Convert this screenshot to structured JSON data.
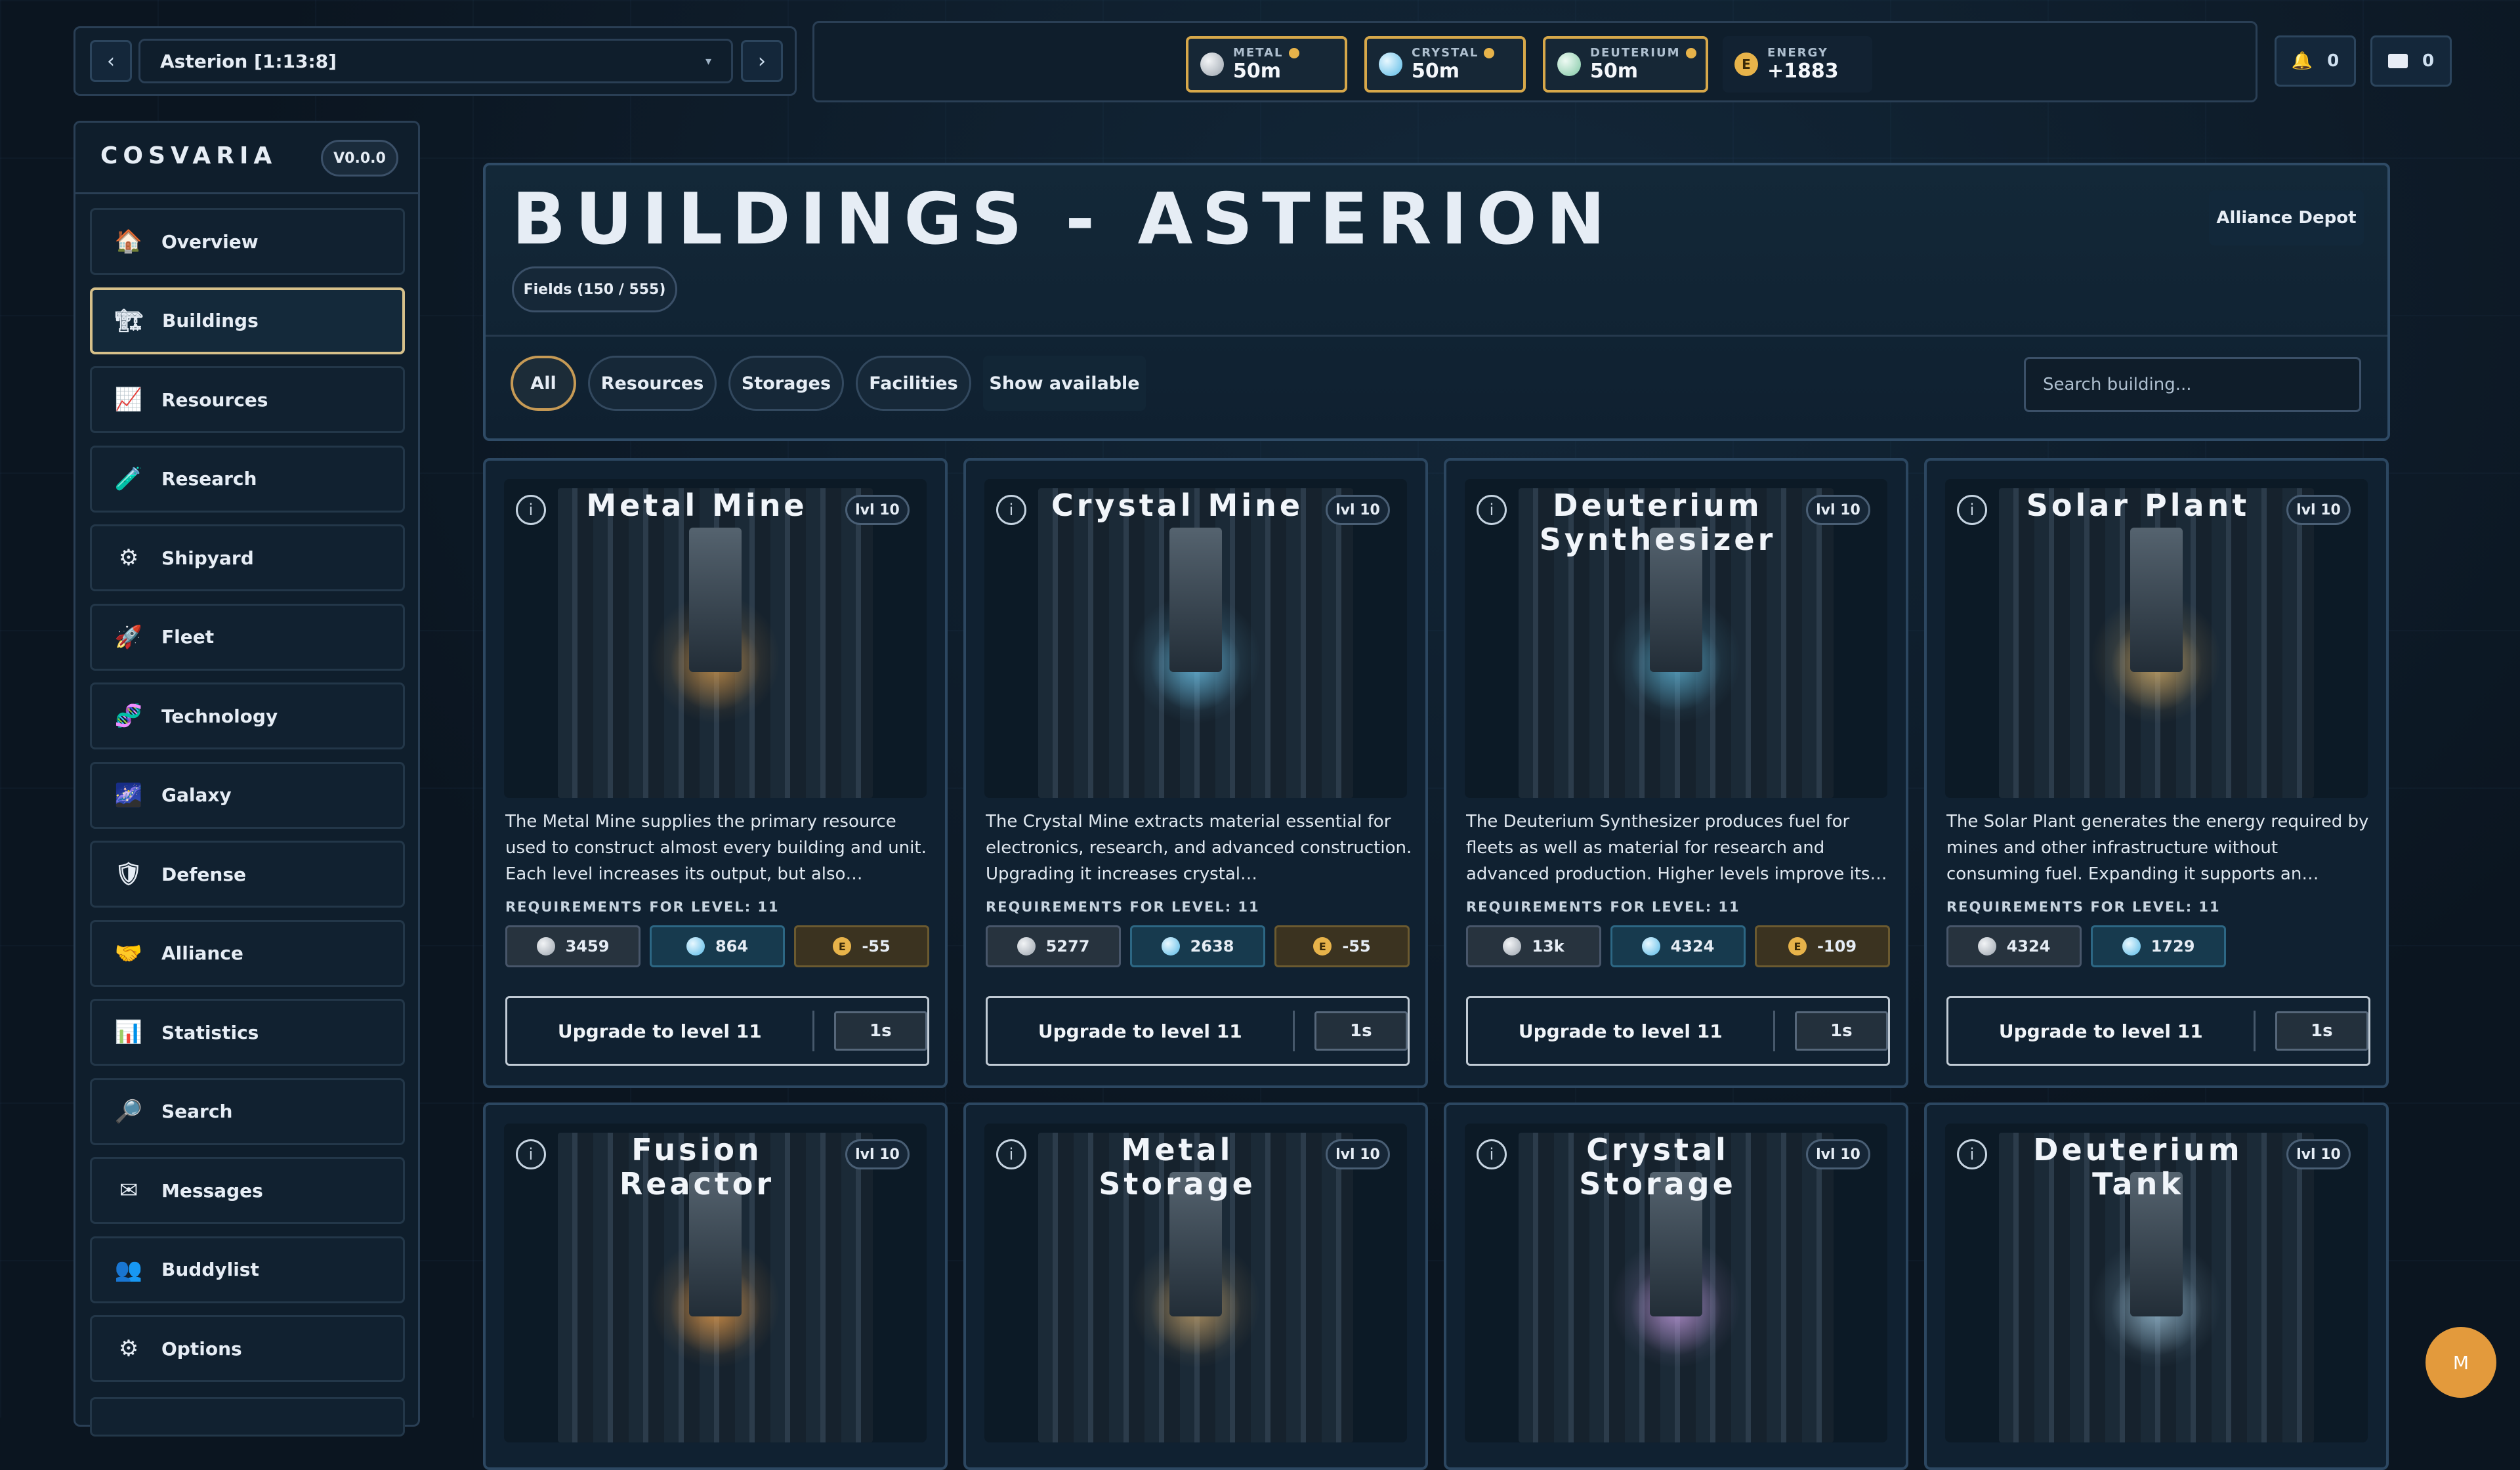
{
  "planet_selector": {
    "current": "Asterion [1:13:8]",
    "prev_icon": "chevron-left-icon",
    "next_icon": "chevron-right-icon"
  },
  "resources": {
    "metal": {
      "label": "METAL",
      "value": "50m",
      "color": "#c9cfd6"
    },
    "crystal": {
      "label": "CRYSTAL",
      "value": "50m",
      "color": "#8fd3f2"
    },
    "deuterium": {
      "label": "DEUTERIUM",
      "value": "50m",
      "color": "#a9e0c8"
    },
    "energy": {
      "label": "ENERGY",
      "value": "+1883",
      "icon_letter": "E",
      "color": "#e7b34a"
    }
  },
  "header_buttons": {
    "notifications_count": "0",
    "messages_count": "0"
  },
  "sidebar": {
    "brand": "COSVARIA",
    "version": "V0.0.0",
    "items": [
      {
        "label": "Overview",
        "icon": "🏠"
      },
      {
        "label": "Buildings",
        "icon": "🏗"
      },
      {
        "label": "Resources",
        "icon": "📈"
      },
      {
        "label": "Research",
        "icon": "🧪"
      },
      {
        "label": "Shipyard",
        "icon": "⚙"
      },
      {
        "label": "Fleet",
        "icon": "🚀"
      },
      {
        "label": "Technology",
        "icon": "🧬"
      },
      {
        "label": "Galaxy",
        "icon": "🌌"
      },
      {
        "label": "Defense",
        "icon": "🛡"
      },
      {
        "label": "Alliance",
        "icon": "🤝"
      },
      {
        "label": "Statistics",
        "icon": "📊"
      },
      {
        "label": "Search",
        "icon": "🔎"
      },
      {
        "label": "Messages",
        "icon": "✉"
      },
      {
        "label": "Buddylist",
        "icon": "👥"
      },
      {
        "label": "Options",
        "icon": "⚙"
      }
    ],
    "active": "Buildings"
  },
  "main": {
    "title": "BUILDINGS - ASTERION",
    "fields": "Fields (150 / 555)",
    "alliance_depot": "Alliance Depot",
    "filters": [
      "All",
      "Resources",
      "Storages",
      "Facilities",
      "Show available"
    ],
    "active_filter": "All",
    "search_placeholder": "Search building..."
  },
  "requirements_label": "REQUIREMENTS FOR LEVEL: 11",
  "buildings": [
    {
      "name": "Metal Mine",
      "level": "lvl 10",
      "description": "The Metal Mine supplies the primary resource used to construct almost every building and unit. Each level increases its output, but also…",
      "costs": {
        "metal": "3459",
        "crystal": "864",
        "energy": "-55"
      },
      "upgrade": "Upgrade to level 11",
      "time": "1s",
      "accent": "#d89a4a"
    },
    {
      "name": "Crystal Mine",
      "level": "lvl 10",
      "description": "The Crystal Mine extracts material essential for electronics, research, and advanced construction. Upgrading it increases crystal…",
      "costs": {
        "metal": "5277",
        "crystal": "2638",
        "energy": "-55"
      },
      "upgrade": "Upgrade to level 11",
      "time": "1s",
      "accent": "#6fc9f0"
    },
    {
      "name": "Deuterium Synthesizer",
      "level": "lvl 10",
      "description": "The Deuterium Synthesizer produces fuel for fleets as well as material for research and advanced production. Higher levels improve its…",
      "costs": {
        "metal": "13k",
        "crystal": "4324",
        "energy": "-109"
      },
      "upgrade": "Upgrade to level 11",
      "time": "1s",
      "accent": "#5fb6d8"
    },
    {
      "name": "Solar Plant",
      "level": "lvl 10",
      "description": "The Solar Plant generates the energy required by mines and other infrastructure without consuming fuel. Expanding it supports an…",
      "costs": {
        "metal": "4324",
        "crystal": "1729"
      },
      "upgrade": "Upgrade to level 11",
      "time": "1s",
      "accent": "#e0b56a"
    },
    {
      "name": "Fusion Reactor",
      "level": "lvl 10",
      "accent": "#f2a24a"
    },
    {
      "name": "Metal Storage",
      "level": "lvl 10",
      "accent": "#c9a46a"
    },
    {
      "name": "Crystal Storage",
      "level": "lvl 10",
      "accent": "#c9a0e6"
    },
    {
      "name": "Deuterium Tank",
      "level": "lvl 10",
      "accent": "#9fc4da"
    }
  ],
  "fab": {
    "label": "M",
    "color": "#e39a3c"
  }
}
